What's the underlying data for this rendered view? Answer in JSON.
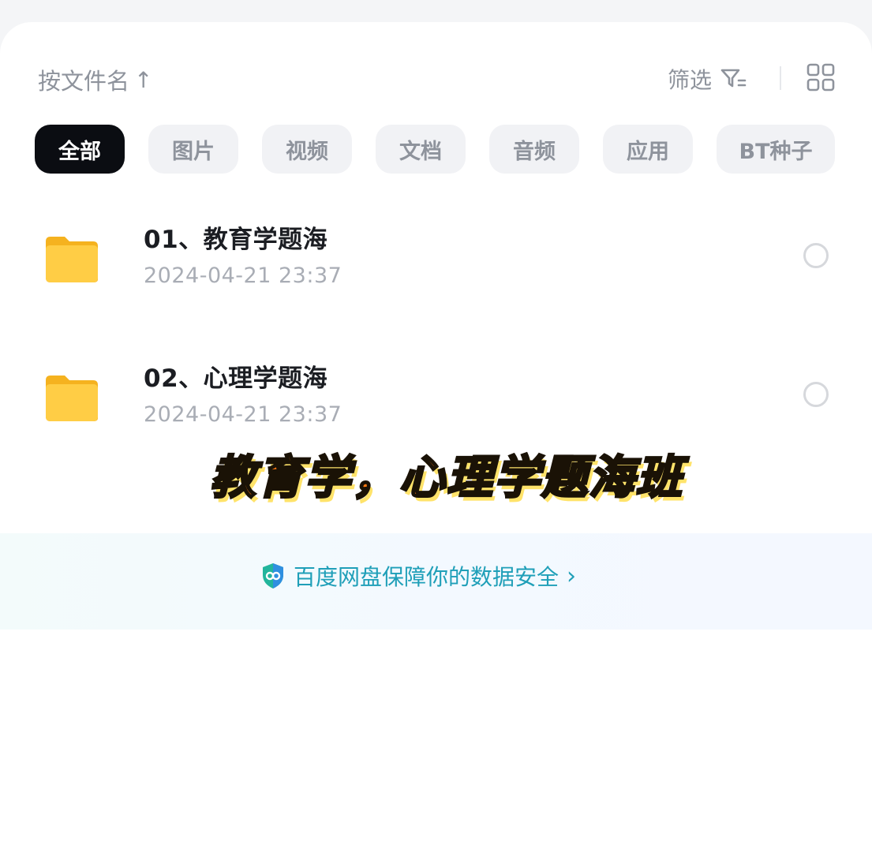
{
  "toolbar": {
    "sort_label": "按文件名",
    "sort_arrow": "↑",
    "filter_label": "筛选"
  },
  "tabs": [
    {
      "label": "全部",
      "active": true
    },
    {
      "label": "图片",
      "active": false
    },
    {
      "label": "视频",
      "active": false
    },
    {
      "label": "文档",
      "active": false
    },
    {
      "label": "音频",
      "active": false
    },
    {
      "label": "应用",
      "active": false
    },
    {
      "label": "BT种子",
      "active": false
    }
  ],
  "files": [
    {
      "name": "01、教育学题海",
      "date": "2024-04-21  23:37",
      "icon": "folder-icon"
    },
    {
      "name": "02、心理学题海",
      "date": "2024-04-21  23:37",
      "icon": "folder-icon"
    }
  ],
  "overlay": {
    "caption": "教育学，心理学题海班"
  },
  "banner": {
    "text": "百度网盘保障你的数据安全",
    "chevron": "›"
  },
  "colors": {
    "accent": "#1f9fb8",
    "folder": "#ffc83d",
    "caption": "#ff7a12",
    "active_tab": "#0b0d12"
  }
}
